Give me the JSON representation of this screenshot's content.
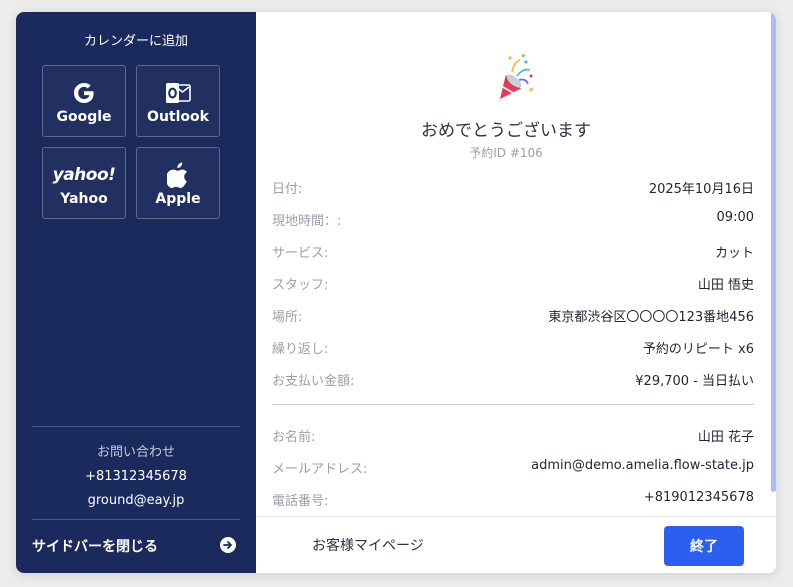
{
  "sidebar": {
    "title": "カレンダーに追加",
    "calendars": [
      {
        "label": "Google",
        "icon": "google-icon"
      },
      {
        "label": "Outlook",
        "icon": "outlook-icon"
      },
      {
        "label": "Yahoo",
        "icon": "yahoo-icon",
        "logo_text": "yahoo!"
      },
      {
        "label": "Apple",
        "icon": "apple-icon"
      }
    ],
    "contact_title": "お問い合わせ",
    "contact_phone": "+81312345678",
    "contact_email": "ground@eay.jp",
    "close_label": "サイドバーを閉じる",
    "close_icon": "arrow-right-circle-icon"
  },
  "main": {
    "title": "おめでとうございます",
    "booking_id": "予約ID #106",
    "details": [
      {
        "key": "日付:",
        "value": "2025年10月16日"
      },
      {
        "key": "現地時間：:",
        "value": "09:00"
      },
      {
        "key": "サービス:",
        "value": "カット"
      },
      {
        "key": "スタッフ:",
        "value": "山田 悟史"
      },
      {
        "key": "場所:",
        "value": "東京都渋谷区〇〇〇〇123番地456"
      },
      {
        "key": "繰り返し:",
        "value": "予約のリピート x6"
      },
      {
        "key": "お支払い金額:",
        "value": "¥29,700 - 当日払い"
      }
    ],
    "customer": [
      {
        "key": "お名前:",
        "value": "山田 花子"
      },
      {
        "key": "メールアドレス:",
        "value": "admin@demo.amelia.flow-state.jp"
      },
      {
        "key": "電話番号:",
        "value": "+819012345678"
      }
    ]
  },
  "footer": {
    "portal_link": "お客様マイページ",
    "finish_button": "終了"
  },
  "colors": {
    "sidebar_bg": "#1a2a5c",
    "primary": "#2a5ff0",
    "scrollbar": "#a9bdf6"
  }
}
